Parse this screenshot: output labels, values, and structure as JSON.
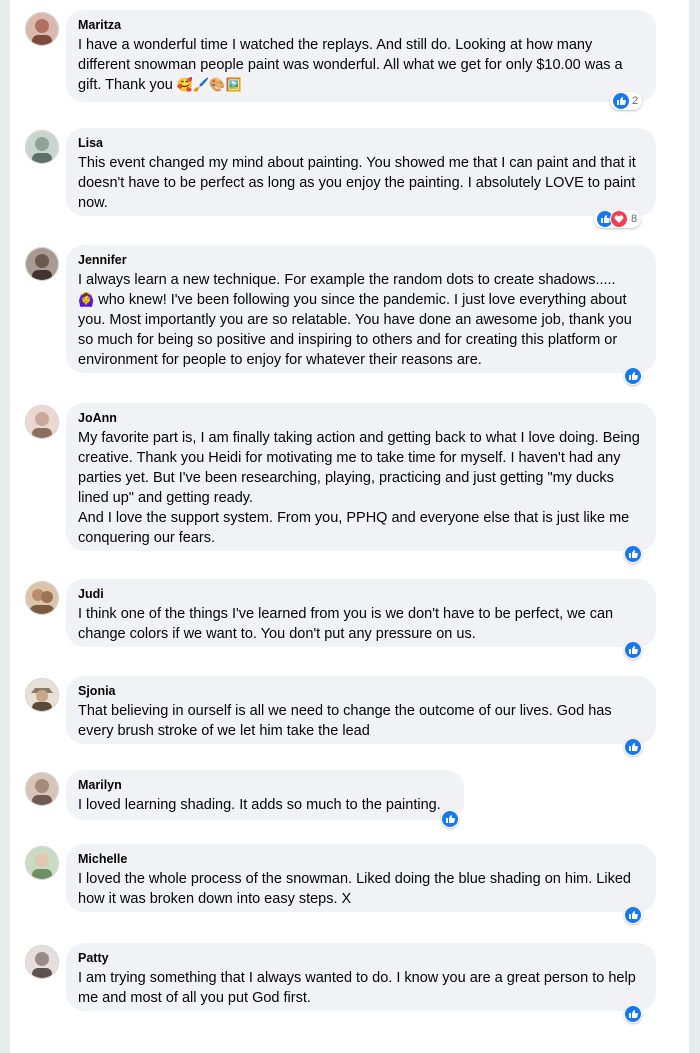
{
  "comments": [
    {
      "name": "Maritza",
      "text": "I have a wonderful time I watched the replays. And still do. Looking at how many different snowman people paint was wonderful. All what we get for only $10.00 was a gift. Thank you",
      "emoji": "🥰🖌️🎨🖼️",
      "reaction_count": "2",
      "avatar_color": "#b07060"
    },
    {
      "name": "Lisa",
      "text": "This event changed my mind about painting. You showed me that I can paint and that it doesn't have to be perfect as long as you enjoy the painting. I absolutely LOVE to paint now.",
      "reaction_count": "8",
      "avatar_color": "#8fa39a"
    },
    {
      "name": "Jennifer",
      "text_line1": "I always learn a new technique. For example the random dots to create shadows.....",
      "emoji": "🙆‍♀️",
      "text_rest": "who knew! I've been following you since the pandemic. I just love everything about you. Most importantly you are so relatable. You have done an awesome job, thank you so much for being so positive and inspiring to others and for creating this platform or environment for people to enjoy for whatever their reasons are.",
      "avatar_color": "#6b5a50"
    },
    {
      "name": "JoAnn",
      "text": "My favorite part is, I am finally taking action and getting back to what I love doing. Being creative. Thank you Heidi for motivating me to take time for myself. I haven't had any parties yet. But I've been researching, playing, practicing and just getting \"my ducks lined up\" and getting ready.",
      "text2": "And I love the support system. From you, PPHQ and everyone else that is just like me conquering our fears.",
      "avatar_color": "#c9a79a"
    },
    {
      "name": "Judi",
      "text": "I think one of the things I've learned from you is we don't have to be perfect, we can change colors if we want to. You don't put any pressure on us.",
      "avatar_color": "#b98e6a"
    },
    {
      "name": "Sjonia",
      "text": "That believing in ourself is all we need to change the outcome of our lives. God has every brush stroke of we let him take the lead",
      "avatar_color": "#8a7a66"
    },
    {
      "name": "Marilyn",
      "text": "I loved learning shading. It adds so much to the painting.",
      "avatar_color": "#a58a78"
    },
    {
      "name": "Michelle",
      "text": "I loved the whole process of the snowman. Liked doing the blue shading on him. Liked how it was broken down into easy steps. X",
      "avatar_color": "#6f8f64"
    },
    {
      "name": "Patty",
      "text": "I am trying something that I always wanted to do. I know you are a great person to help me and most of all you put God first.",
      "avatar_color": "#9a8a86"
    }
  ],
  "colors": {
    "like": "#1877f2",
    "love": "#f33e58",
    "bubble": "#f0f2f5"
  }
}
